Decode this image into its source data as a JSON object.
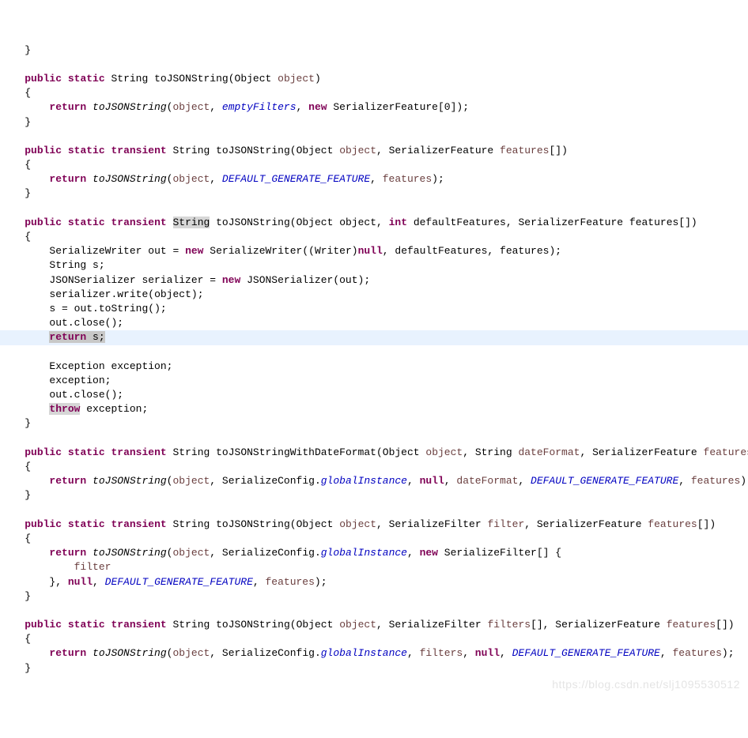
{
  "kw": {
    "public": "public",
    "static": "static",
    "transient": "transient",
    "return": "return",
    "new": "new",
    "null": "null",
    "int": "int",
    "throw": "throw"
  },
  "method": {
    "toJSONString": "toJSONString",
    "toJSONStringWithDateFormat": "toJSONStringWithDateFormat"
  },
  "ty": {
    "String": "String",
    "Object": "Object",
    "SerializerFeature": "SerializerFeature",
    "SerializeWriter": "SerializeWriter",
    "Writer": "Writer",
    "JSONSerializer": "JSONSerializer",
    "Exception": "Exception",
    "SerializeFilter": "SerializeFilter",
    "SerializeConfig": "SerializeConfig"
  },
  "p": {
    "object": "object",
    "features": "features",
    "filter": "filter",
    "filters": "filters",
    "dateFormat": "dateFormat"
  },
  "fld": {
    "emptyFilters": "emptyFilters",
    "DEFAULT_GENERATE_FEATURE": "DEFAULT_GENERATE_FEATURE",
    "globalInstance": "globalInstance"
  },
  "txt": {
    "brace_close": "}",
    "brace_open": "{",
    "zero": "0",
    "defaultFeatures": "defaultFeatures",
    "out": "out",
    "s": "s",
    "serializer": "serializer",
    "write": "write",
    "toString": "toString",
    "close": "close",
    "exception": "exception",
    "returns_semi": "return s;"
  },
  "watermark": "https://blog.csdn.net/slj1095530512"
}
